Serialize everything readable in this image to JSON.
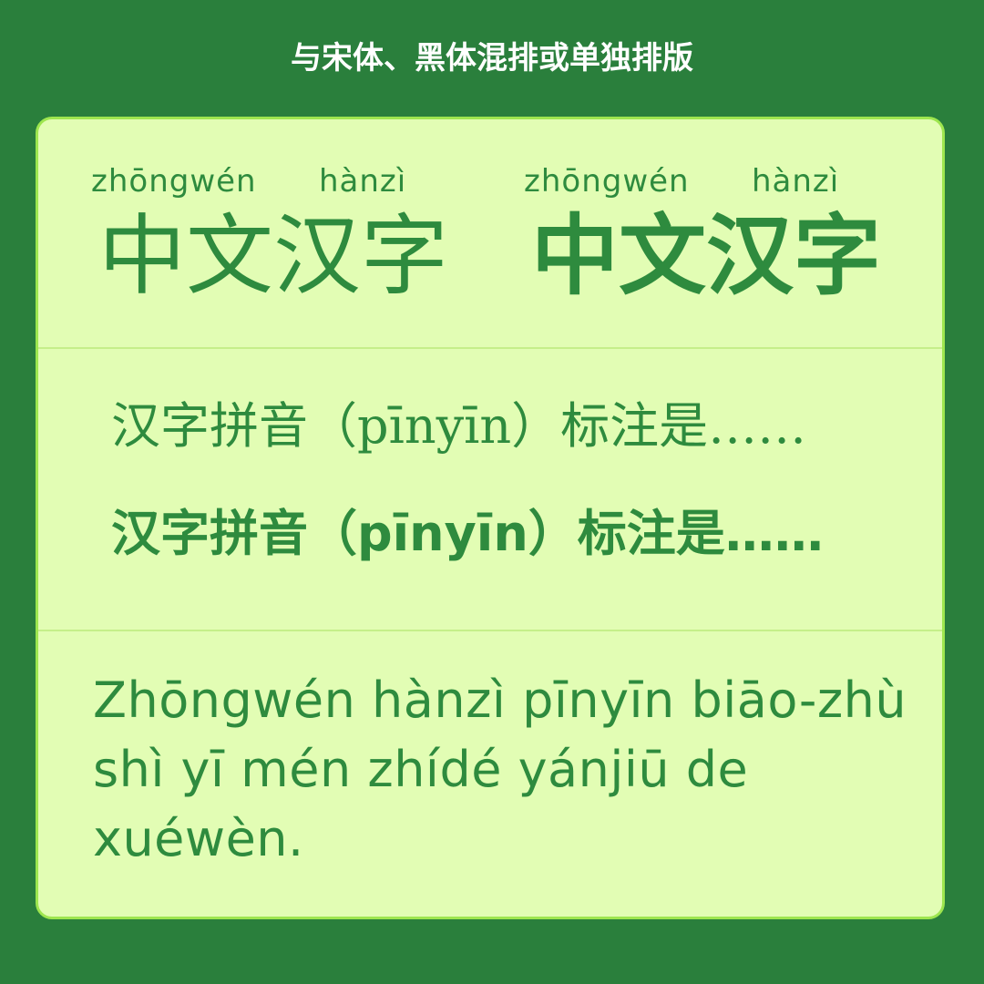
{
  "header": {
    "title": "与宋体、黑体混排或单独排版"
  },
  "ruby_section": {
    "serif_block": {
      "pinyin": [
        "zhōngwén",
        "hànzì"
      ],
      "hanzi": "中文汉字"
    },
    "sans_block": {
      "pinyin": [
        "zhōngwén",
        "hànzì"
      ],
      "hanzi": "中文汉字"
    }
  },
  "mixed_section": {
    "serif_line": "汉字拼音（pīnyīn）标注是……",
    "sans_line": "汉字拼音（pīnyīn）标注是……"
  },
  "paragraph_section": {
    "text": "Zhōngwén hànzì pīnyīn biāo-zhù shì yī mén zhídé yánjiū de xuéwèn."
  },
  "colors": {
    "background": "#2a7f3c",
    "card": "#e2fdb4",
    "card_border": "#9ee64f",
    "text_green": "#2e8b3e",
    "header_text": "#ffffff"
  }
}
